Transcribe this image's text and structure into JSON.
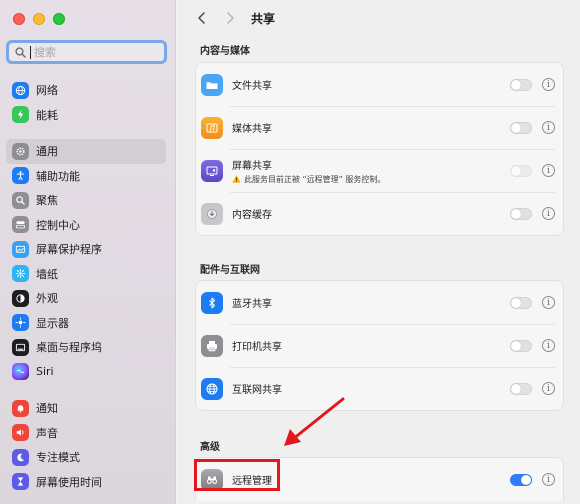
{
  "window": {
    "title": "共享"
  },
  "sidebar": {
    "search_placeholder": "搜索",
    "items": [
      {
        "label": "网络",
        "icon": "globe-icon",
        "color": "#1e7cf2"
      },
      {
        "label": "能耗",
        "icon": "bolt-icon",
        "color": "#35c759"
      },
      {
        "label": "通用",
        "icon": "gear-icon",
        "color": "#8e8e93",
        "active": true
      },
      {
        "label": "辅助功能",
        "icon": "accessibility-icon",
        "color": "#1e7cf2"
      },
      {
        "label": "聚焦",
        "icon": "magnifier-icon",
        "color": "#8e8e93"
      },
      {
        "label": "控制中心",
        "icon": "control-center-icon",
        "color": "#8e8e93"
      },
      {
        "label": "屏幕保护程序",
        "icon": "screensaver-icon",
        "color": "#3aa0f0"
      },
      {
        "label": "墙纸",
        "icon": "wallpaper-icon",
        "color": "#2fb4f0"
      },
      {
        "label": "外观",
        "icon": "appearance-icon",
        "color": "#1d1d1f"
      },
      {
        "label": "显示器",
        "icon": "display-icon",
        "color": "#1e7cf2"
      },
      {
        "label": "桌面与程序坞",
        "icon": "dock-icon",
        "color": "#1d1d1f"
      },
      {
        "label": "Siri",
        "icon": "siri-icon",
        "color": "#3b3b6b"
      },
      {
        "label": "通知",
        "icon": "bell-icon",
        "color": "#f0453a"
      },
      {
        "label": "声音",
        "icon": "speaker-icon",
        "color": "#f0453a"
      },
      {
        "label": "专注模式",
        "icon": "moon-icon",
        "color": "#5e5ce6"
      },
      {
        "label": "屏幕使用时间",
        "icon": "hourglass-icon",
        "color": "#5e5ce6"
      }
    ]
  },
  "sections": [
    {
      "title": "内容与媒体",
      "rows": [
        {
          "label": "文件共享",
          "icon": "folder-icon",
          "color": "#4aa6f5",
          "toggle": false
        },
        {
          "label": "媒体共享",
          "icon": "media-icon",
          "color": "#f5a623",
          "toggle": false
        },
        {
          "label": "屏幕共享",
          "icon": "screen-share-icon",
          "color": "#6a5acd",
          "toggle": false,
          "disabled": true,
          "note": "此服务目前正被 “远程管理” 服务控制。"
        },
        {
          "label": "内容缓存",
          "icon": "cache-icon",
          "color": "#b0b0b4",
          "toggle": false
        }
      ]
    },
    {
      "title": "配件与互联网",
      "rows": [
        {
          "label": "蓝牙共享",
          "icon": "bluetooth-icon",
          "color": "#1e7cf2",
          "toggle": false
        },
        {
          "label": "打印机共享",
          "icon": "printer-icon",
          "color": "#8e8e93",
          "toggle": false
        },
        {
          "label": "互联网共享",
          "icon": "globe-icon",
          "color": "#1e7cf2",
          "toggle": false
        }
      ]
    },
    {
      "title": "高级",
      "rows": [
        {
          "label": "远程管理",
          "icon": "binoculars-icon",
          "color": "#8e8e93",
          "toggle": true
        }
      ]
    }
  ],
  "info_glyph": "i",
  "accent": "#2f7cf6",
  "annotation_color": "#e3161c"
}
